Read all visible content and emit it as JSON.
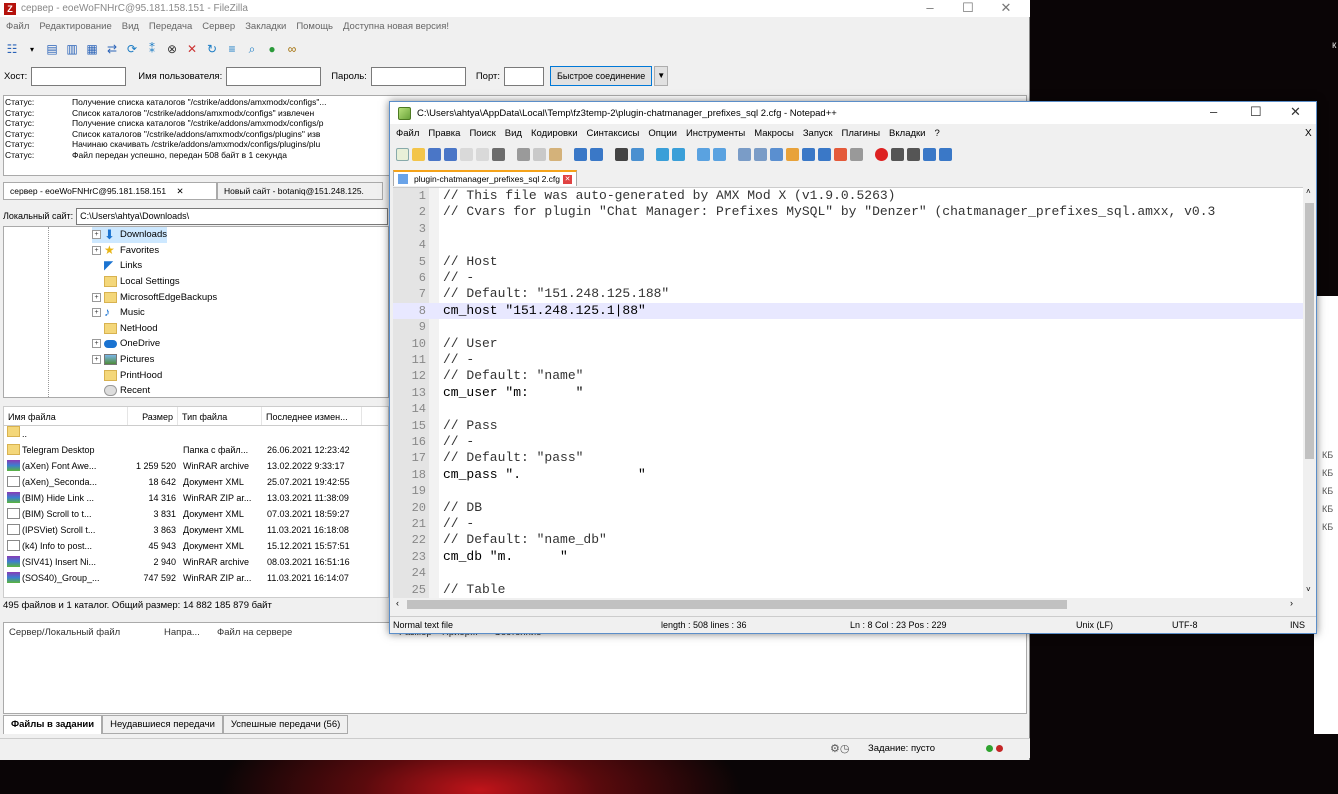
{
  "filezilla": {
    "title": "сервер - eoeWoFNHrC@95.181.158.151 - FileZilla",
    "logo": "Z",
    "menu": [
      "Файл",
      "Редактирование",
      "Вид",
      "Передача",
      "Сервер",
      "Закладки",
      "Помощь",
      "Доступна новая версия!"
    ],
    "quickconnect": {
      "host_label": "Хост:",
      "user_label": "Имя пользователя:",
      "pass_label": "Пароль:",
      "port_label": "Порт:",
      "connect_button": "Быстрое соединение",
      "host_value": "",
      "user_value": "",
      "pass_value": "",
      "port_value": ""
    },
    "log": [
      {
        "key": "Статус:",
        "msg": "Получение списка каталогов \"/cstrike/addons/amxmodx/configs\"..."
      },
      {
        "key": "Статус:",
        "msg": "Список каталогов \"/cstrike/addons/amxmodx/configs\" извлечен"
      },
      {
        "key": "Статус:",
        "msg": "Получение списка каталогов \"/cstrike/addons/amxmodx/configs/p"
      },
      {
        "key": "Статус:",
        "msg": "Список каталогов \"/cstrike/addons/amxmodx/configs/plugins\" изв"
      },
      {
        "key": "Статус:",
        "msg": "Начинаю скачивать /cstrike/addons/amxmodx/configs/plugins/plu"
      },
      {
        "key": "Статус:",
        "msg": "Файл передан успешно, передан 508 байт в 1 секунда"
      }
    ],
    "tabs": [
      {
        "label": "сервер - eoeWoFNHrC@95.181.158.151",
        "close": "✕"
      },
      {
        "label": "Новый сайт - botaniq@151.248.125."
      }
    ],
    "local_site_label": "Локальный сайт:",
    "local_site_path": "C:\\Users\\ahtya\\Downloads\\",
    "tree": [
      {
        "label": "Downloads",
        "expander": "⊞",
        "icon": "download",
        "selected": true
      },
      {
        "label": "Favorites",
        "expander": "⊞",
        "icon": "star"
      },
      {
        "label": "Links",
        "expander": "",
        "icon": "link"
      },
      {
        "label": "Local Settings",
        "expander": "",
        "icon": "folder"
      },
      {
        "label": "MicrosoftEdgeBackups",
        "expander": "⊞",
        "icon": "folder"
      },
      {
        "label": "Music",
        "expander": "⊞",
        "icon": "music"
      },
      {
        "label": "NetHood",
        "expander": "",
        "icon": "folder"
      },
      {
        "label": "OneDrive",
        "expander": "⊞",
        "icon": "cloud"
      },
      {
        "label": "Pictures",
        "expander": "⊞",
        "icon": "pictures"
      },
      {
        "label": "PrintHood",
        "expander": "",
        "icon": "folder"
      },
      {
        "label": "Recent",
        "expander": "",
        "icon": "recent"
      }
    ],
    "file_headers": [
      "Имя файла",
      "Размер",
      "Тип файла",
      "Последнее измен..."
    ],
    "files": [
      {
        "name": "..",
        "size": "",
        "type": "",
        "date": "",
        "icon": "folder"
      },
      {
        "name": "Telegram Desktop",
        "size": "",
        "type": "Папка с файл...",
        "date": "26.06.2021 12:23:42",
        "icon": "folder"
      },
      {
        "name": "(aXen) Font Awe...",
        "size": "1 259 520",
        "type": "WinRAR archive",
        "date": "13.02.2022 9:33:17",
        "icon": "rar"
      },
      {
        "name": "(aXen)_Seconda...",
        "size": "18 642",
        "type": "Документ XML",
        "date": "25.07.2021 19:42:55",
        "icon": "xml"
      },
      {
        "name": "(BIM) Hide Link ...",
        "size": "14 316",
        "type": "WinRAR ZIP ar...",
        "date": "13.03.2021 11:38:09",
        "icon": "rar"
      },
      {
        "name": "(BIM) Scroll to t...",
        "size": "3 831",
        "type": "Документ XML",
        "date": "07.03.2021 18:59:27",
        "icon": "xml"
      },
      {
        "name": "(IPSViet) Scroll t...",
        "size": "3 863",
        "type": "Документ XML",
        "date": "11.03.2021 16:18:08",
        "icon": "xml"
      },
      {
        "name": "(k4) Info to post...",
        "size": "45 943",
        "type": "Документ XML",
        "date": "15.12.2021 15:57:51",
        "icon": "xml"
      },
      {
        "name": "(SIV41) Insert Ni...",
        "size": "2 940",
        "type": "WinRAR archive",
        "date": "08.03.2021 16:51:16",
        "icon": "rar"
      },
      {
        "name": "(SOS40)_Group_...",
        "size": "747 592",
        "type": "WinRAR ZIP ar...",
        "date": "11.03.2021 16:14:07",
        "icon": "rar"
      }
    ],
    "summary": "495 файлов и 1 каталог. Общий размер: 14 882 185 879 байт",
    "queue_headers": [
      "Сервер/Локальный файл",
      "Напра...",
      "Файл на сервере",
      "Размер",
      "Приор...",
      "Состояние"
    ],
    "queue_tabs": [
      "Файлы в задании",
      "Неудавшиеся передачи",
      "Успешные передачи (56)"
    ],
    "queue_status": "Задание: пусто"
  },
  "notepad": {
    "title": "C:\\Users\\ahtya\\AppData\\Local\\Temp\\fz3temp-2\\plugin-chatmanager_prefixes_sql 2.cfg - Notepad++",
    "menu": [
      "Файл",
      "Правка",
      "Поиск",
      "Вид",
      "Кодировки",
      "Синтаксисы",
      "Опции",
      "Инструменты",
      "Макросы",
      "Запуск",
      "Плагины",
      "Вкладки",
      "?"
    ],
    "menu_close": "X",
    "tab": "plugin-chatmanager_prefixes_sql 2.cfg",
    "tab_close": "✕",
    "lines": [
      {
        "n": "1",
        "t": "// This file was auto-generated by AMX Mod X (v1.9.0.5263)"
      },
      {
        "n": "2",
        "t": "// Cvars for plugin \"Chat Manager: Prefixes MySQL\" by \"Denzer\" (chatmanager_prefixes_sql.amxx, v0.3"
      },
      {
        "n": "3",
        "t": ""
      },
      {
        "n": "4",
        "t": ""
      },
      {
        "n": "5",
        "t": "// Host"
      },
      {
        "n": "6",
        "t": "// -"
      },
      {
        "n": "7",
        "t": "// Default: \"151.248.125.188\""
      },
      {
        "n": "8",
        "t": "cm_host \"151.248.125.1|88\"",
        "current": true
      },
      {
        "n": "9",
        "t": ""
      },
      {
        "n": "10",
        "t": "// User"
      },
      {
        "n": "11",
        "t": "// -"
      },
      {
        "n": "12",
        "t": "// Default: \"name\""
      },
      {
        "n": "13",
        "t": "cm_user \"m:      \""
      },
      {
        "n": "14",
        "t": ""
      },
      {
        "n": "15",
        "t": "// Pass"
      },
      {
        "n": "16",
        "t": "// -"
      },
      {
        "n": "17",
        "t": "// Default: \"pass\""
      },
      {
        "n": "18",
        "t": "cm_pass \".               \""
      },
      {
        "n": "19",
        "t": ""
      },
      {
        "n": "20",
        "t": "// DB"
      },
      {
        "n": "21",
        "t": "// -"
      },
      {
        "n": "22",
        "t": "// Default: \"name_db\""
      },
      {
        "n": "23",
        "t": "cm_db \"m.      \""
      },
      {
        "n": "24",
        "t": ""
      },
      {
        "n": "25",
        "t": "// Table"
      }
    ],
    "status": {
      "type": "Normal text file",
      "length": "length : 508    lines : 36",
      "pos": "Ln : 8    Col : 23    Pos : 229",
      "eol": "Unix (LF)",
      "enc": "UTF-8",
      "ins": "INS"
    }
  },
  "background": {
    "right_labels": [
      "КБ",
      "КБ",
      "КБ",
      "КБ",
      "КБ"
    ],
    "corner_char": "к"
  },
  "colors": {
    "filezilla_red": "#b5120c",
    "notepad_tab_accent": "#f5a31a",
    "current_line": "#e8e8ff"
  }
}
